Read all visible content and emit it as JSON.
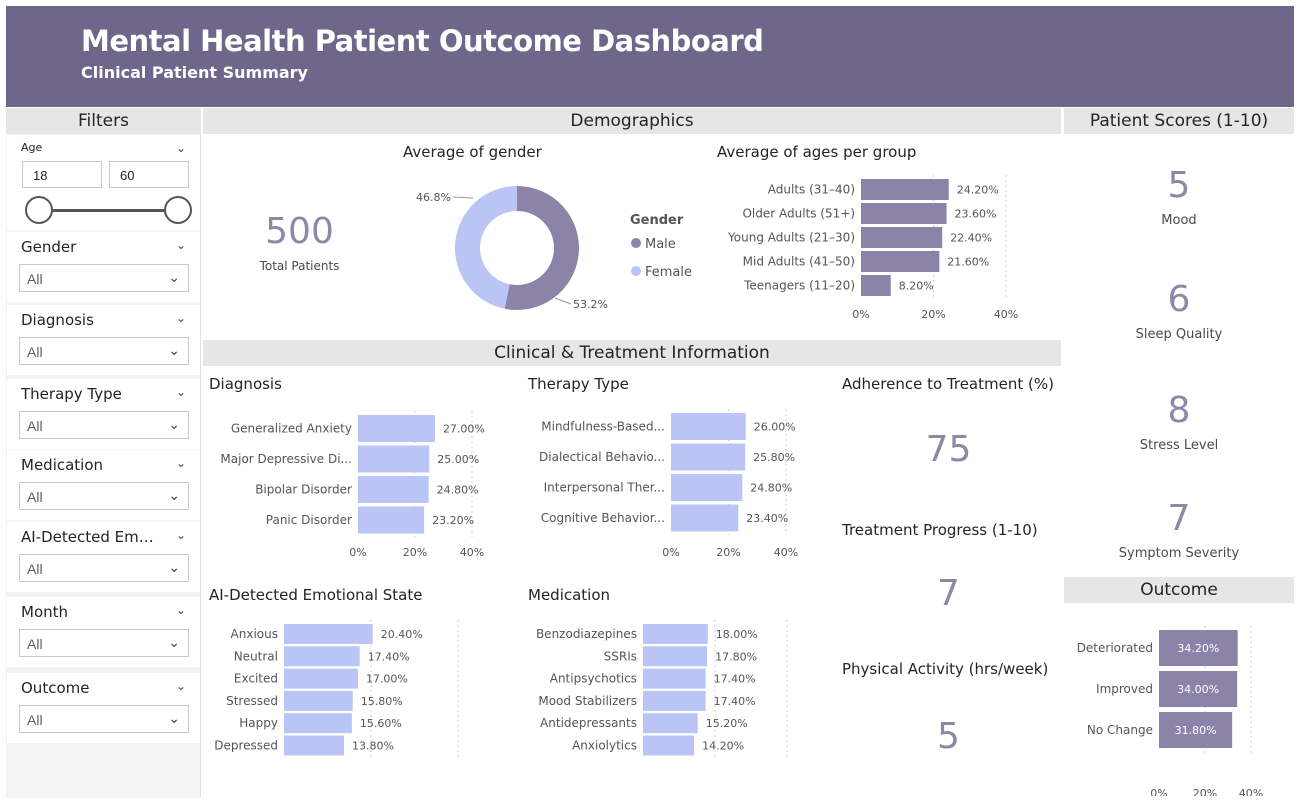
{
  "header": {
    "title": "Mental Health Patient Outcome Dashboard",
    "subtitle": "Clinical Patient Summary",
    "bg_color": "#6e668b"
  },
  "sections": {
    "filters": "Filters",
    "demographics": "Demographics",
    "clinical": "Clinical & Treatment Information",
    "scores": "Patient Scores (1-10)",
    "outcome": "Outcome"
  },
  "filters": {
    "age": {
      "label": "Age",
      "min": "18",
      "max": "60"
    },
    "items": [
      {
        "label": "Gender",
        "value": "All"
      },
      {
        "label": "Diagnosis",
        "value": "All"
      },
      {
        "label": "Therapy Type",
        "value": "All"
      },
      {
        "label": "Medication",
        "value": "All"
      },
      {
        "label": "AI-Detected Emo...",
        "value": "All"
      },
      {
        "label": "Month",
        "value": "All"
      },
      {
        "label": "Outcome",
        "value": "All"
      }
    ]
  },
  "kpis": {
    "total_patients": {
      "value": "500",
      "label": "Total Patients"
    },
    "adherence": {
      "title": "Adherence to Treatment (%)",
      "value": "75"
    },
    "treatment_progress": {
      "title": "Treatment Progress (1-10)",
      "value": "7"
    },
    "physical_activity": {
      "title": "Physical Activity (hrs/week)",
      "value": "5"
    }
  },
  "scores": [
    {
      "value": "5",
      "label": "Mood"
    },
    {
      "value": "6",
      "label": "Sleep Quality"
    },
    {
      "value": "8",
      "label": "Stress Level"
    },
    {
      "value": "7",
      "label": "Symptom Severity"
    }
  ],
  "colors": {
    "purple": "#8b83a8",
    "blue": "#bac5f6",
    "kpi_text": "#8e88a6"
  },
  "chart_data": [
    {
      "id": "gender",
      "type": "pie",
      "title": "Average of gender",
      "legend_title": "Gender",
      "categories": [
        "Male",
        "Female"
      ],
      "values": [
        53.2,
        46.8
      ],
      "labels": [
        "53.2%",
        "46.8%"
      ],
      "legend_position": "right"
    },
    {
      "id": "age_groups",
      "type": "bar",
      "title": "Average of ages per group",
      "categories": [
        "Adults (31–40)",
        "Older Adults (51+)",
        "Young Adults (21–30)",
        "Mid Adults (41–50)",
        "Teenagers (11–20)"
      ],
      "values": [
        24.2,
        23.6,
        22.4,
        21.6,
        8.2
      ],
      "labels": [
        "24.20%",
        "23.60%",
        "22.40%",
        "21.60%",
        "8.20%"
      ],
      "ticks": [
        "0%",
        "20%",
        "40%"
      ],
      "xlim": [
        0,
        40
      ]
    },
    {
      "id": "diagnosis",
      "type": "bar",
      "title": "Diagnosis",
      "categories": [
        "Generalized Anxiety",
        "Major Depressive Di...",
        "Bipolar Disorder",
        "Panic Disorder"
      ],
      "values": [
        27.0,
        25.0,
        24.8,
        23.2
      ],
      "labels": [
        "27.00%",
        "25.00%",
        "24.80%",
        "23.20%"
      ],
      "ticks": [
        "0%",
        "20%",
        "40%"
      ],
      "xlim": [
        0,
        40
      ]
    },
    {
      "id": "therapy",
      "type": "bar",
      "title": "Therapy Type",
      "categories": [
        "Mindfulness-Based...",
        "Dialectical Behavio...",
        "Interpersonal Ther...",
        "Cognitive Behavior..."
      ],
      "values": [
        26.0,
        25.8,
        24.8,
        23.4
      ],
      "labels": [
        "26.00%",
        "25.80%",
        "24.80%",
        "23.40%"
      ],
      "ticks": [
        "0%",
        "20%",
        "40%"
      ],
      "xlim": [
        0,
        40
      ]
    },
    {
      "id": "emotion",
      "type": "bar",
      "title": "AI-Detected Emotional State",
      "categories": [
        "Anxious",
        "Neutral",
        "Excited",
        "Stressed",
        "Happy",
        "Depressed"
      ],
      "values": [
        20.4,
        17.4,
        17.0,
        15.8,
        15.6,
        13.8
      ],
      "labels": [
        "20.40%",
        "17.40%",
        "17.00%",
        "15.80%",
        "15.60%",
        "13.80%"
      ],
      "ticks": [
        "0%",
        "20%",
        "40%"
      ],
      "xlim": [
        0,
        40
      ]
    },
    {
      "id": "medication",
      "type": "bar",
      "title": "Medication",
      "categories": [
        "Benzodiazepines",
        "SSRIs",
        "Antipsychotics",
        "Mood Stabilizers",
        "Antidepressants",
        "Anxiolytics"
      ],
      "values": [
        18.0,
        17.8,
        17.4,
        17.4,
        15.2,
        14.2
      ],
      "labels": [
        "18.00%",
        "17.80%",
        "17.40%",
        "17.40%",
        "15.20%",
        "14.20%"
      ],
      "ticks": [
        "0%",
        "20%",
        "40%"
      ],
      "xlim": [
        0,
        40
      ]
    },
    {
      "id": "outcome",
      "type": "bar",
      "categories": [
        "Deteriorated",
        "Improved",
        "No Change"
      ],
      "values": [
        34.2,
        34.0,
        31.8
      ],
      "labels": [
        "34.20%",
        "34.00%",
        "31.80%"
      ],
      "ticks": [
        "0%",
        "20%",
        "40%"
      ],
      "xlim": [
        0,
        40
      ]
    }
  ]
}
